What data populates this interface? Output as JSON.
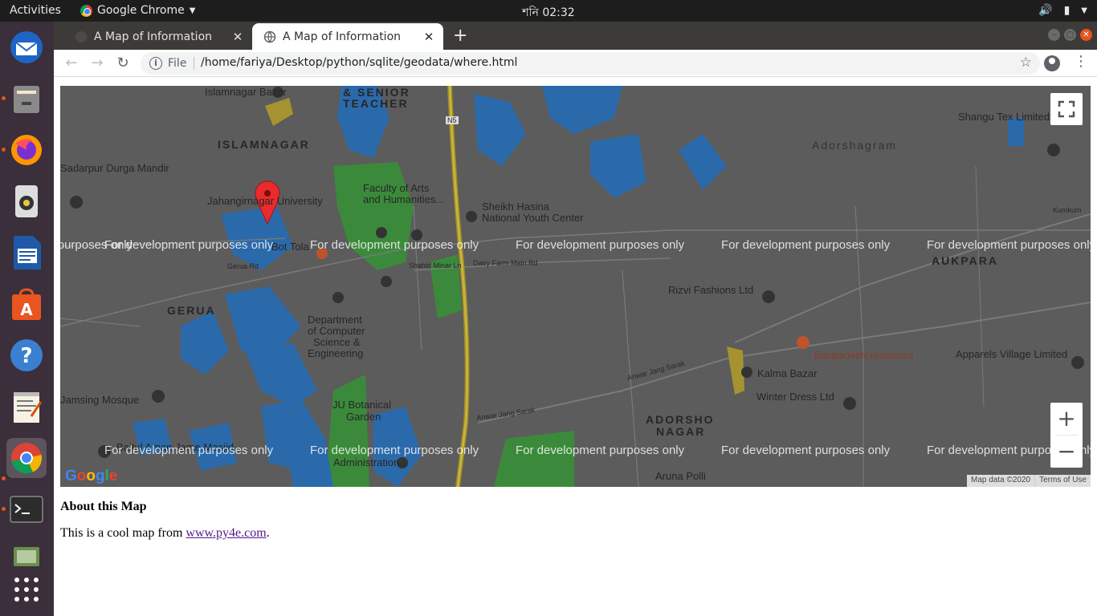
{
  "topbar": {
    "activities": "Activities",
    "app_name": "Google Chrome",
    "clock": "শনি 02:32"
  },
  "dock": {
    "items": [
      "thunderbird-icon",
      "files-icon",
      "firefox-icon",
      "rhythmbox-icon",
      "libreoffice-writer-icon",
      "software-center-icon",
      "help-icon",
      "text-editor-icon",
      "chrome-icon",
      "terminal-icon",
      "shotwell-icon",
      "app-grid-icon"
    ]
  },
  "browser": {
    "tabs": [
      {
        "label": "A Map of Information",
        "active": false
      },
      {
        "label": "A Map of Information",
        "active": true
      }
    ],
    "omnibox": {
      "scheme": "File",
      "url": "/home/fariya/Desktop/python/sqlite/geodata/where.html"
    }
  },
  "map": {
    "dev_watermark": "For development purposes only",
    "areas": [
      "ISLAMNAGAR",
      "GERUA",
      "Adorshagram",
      "AUKPARA",
      "ADORSHO",
      "NAGAR",
      "& SENIOR",
      "TEACHER"
    ],
    "pois": {
      "islamnagar_bazar": "Islamnagar Bazar",
      "sadarpur": "Sadarpur Durga Mandir",
      "ju": "Jahangirnagar University",
      "faculty_1": "Faculty of Arts",
      "faculty_2": "and Humanities...",
      "sheikh_1": "Sheikh Hasina",
      "sheikh_2": "National Youth Center",
      "bot_tola": "Bot Tola",
      "dept_1": "Department",
      "dept_2": "of Computer",
      "dept_3": "Science &",
      "dept_4": "Engineering",
      "jamsing": "Jamsing Mosque",
      "botanical_1": "JU Botanical",
      "botanical_2": "Garden",
      "baitul": "Baitul Aman Jame Masjid",
      "admin": "Administration...",
      "shangu": "Shangu Tex Limited",
      "rizvi": "Rizvi Fashions Ltd",
      "restaurant": "Bangladeshi restaurant",
      "kalma": "Kalma Bazar",
      "winter": "Winter Dress Ltd",
      "apparels": "Apparels Village Limited",
      "aruna": "Aruna Polli"
    },
    "roads": {
      "n5": "N5",
      "gerua_rd": "Gerua Rd",
      "dairy": "Dairy Farm Main Rd",
      "anwar": "Anwar Jang Sarak",
      "anwar2": "Anwar Jang Sarak",
      "shahid": "Shahid Minar Ln",
      "kumkum": "Kumkum"
    },
    "zoom_in": "+",
    "zoom_out": "−",
    "google": "Google",
    "attribution": "Map data ©2020",
    "terms": "Terms of Use"
  },
  "content": {
    "heading": "About this Map",
    "text_before": "This is a cool map from ",
    "link": "www.py4e.com",
    "text_after": "."
  }
}
